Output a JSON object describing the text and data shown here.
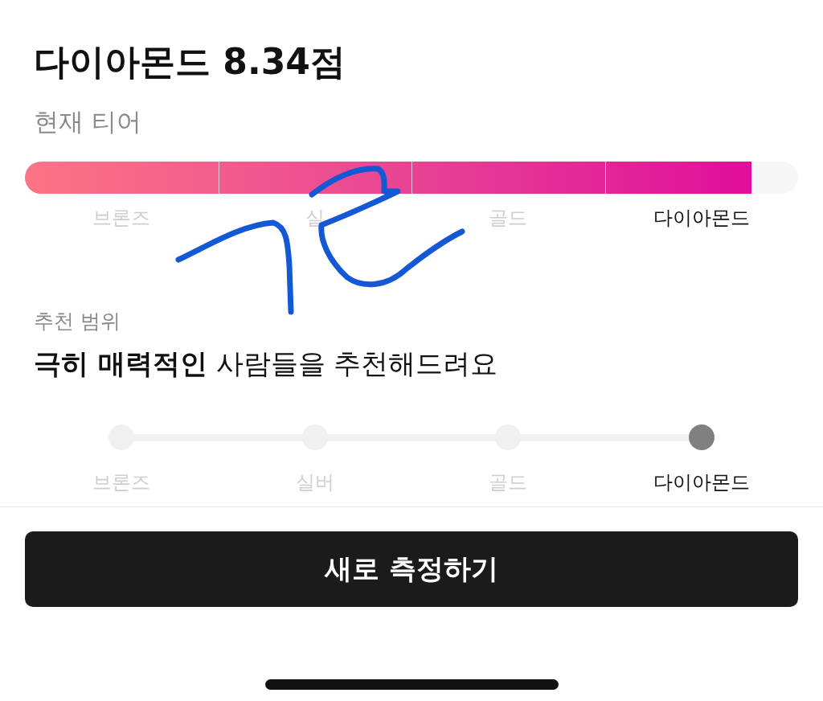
{
  "score_title": "다이아몬드 8.34점",
  "current_tier": {
    "label": "현재 티어",
    "level": 0.94,
    "tiers": [
      {
        "label": "브론즈",
        "selected": false
      },
      {
        "label": "실",
        "selected": false
      },
      {
        "label": "골드",
        "selected": false
      },
      {
        "label": "다이아몬드",
        "selected": true
      }
    ]
  },
  "recommendation": {
    "label": "추천 범위",
    "sentence": "**극히 매력적인** 사람들을 추천해드려요",
    "steps": [
      {
        "label": "브론즈",
        "selected": false
      },
      {
        "label": "실버",
        "selected": false
      },
      {
        "label": "골드",
        "selected": false
      },
      {
        "label": "다이아몬드",
        "selected": true
      }
    ]
  },
  "button": "새로 측정하기"
}
